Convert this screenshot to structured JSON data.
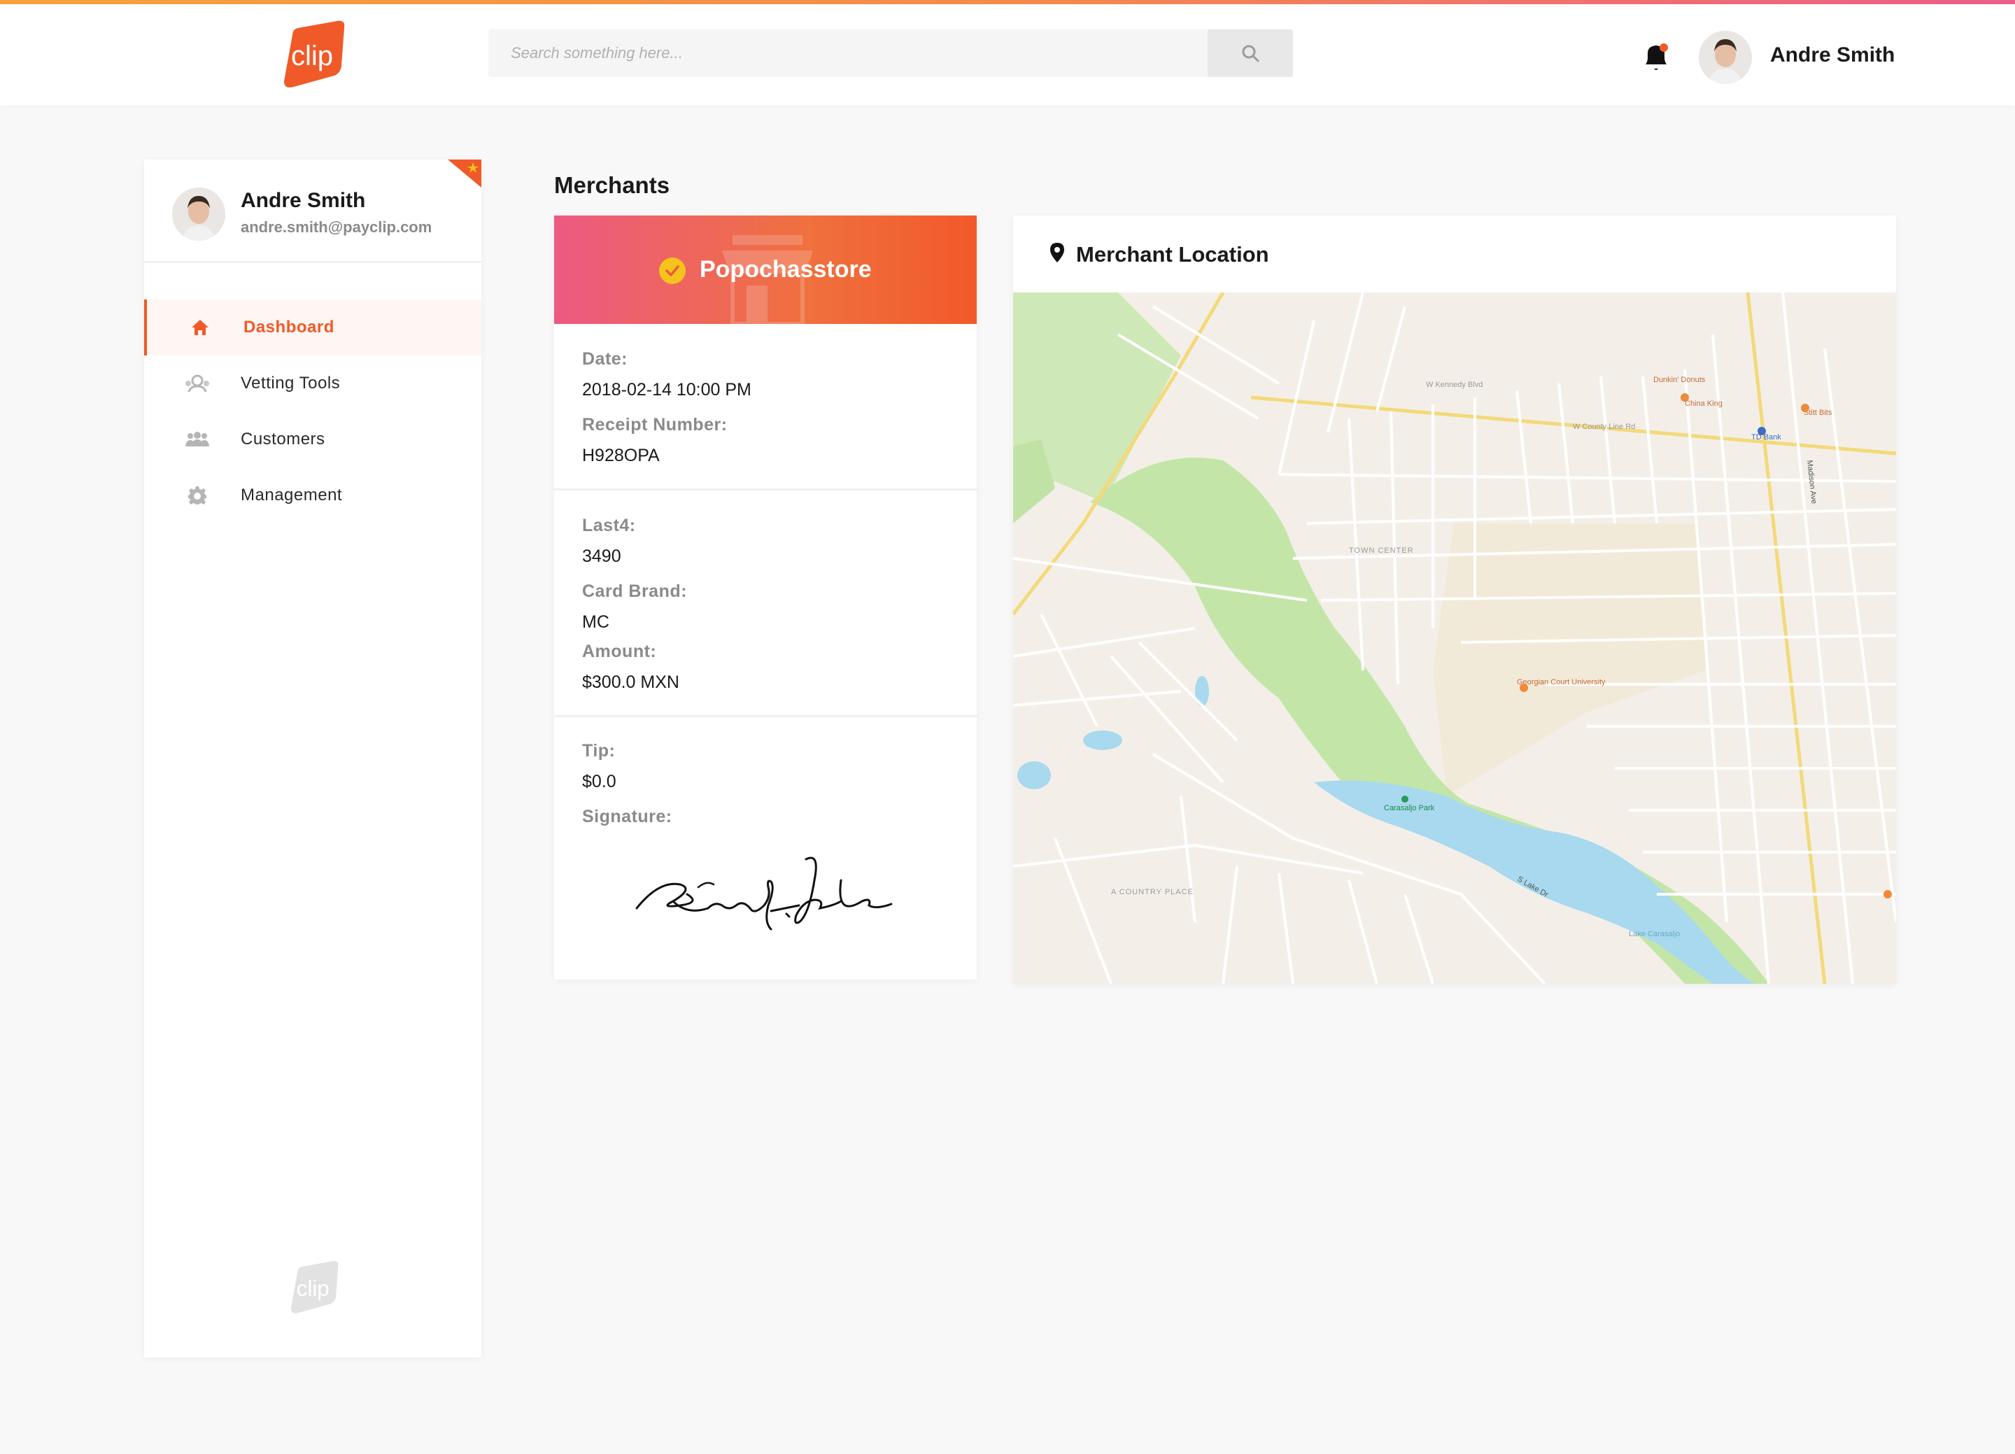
{
  "header": {
    "search": {
      "placeholder": "Search something here...",
      "value": ""
    },
    "user_name": "Andre Smith",
    "icons": [
      "clip-logo",
      "search-icon",
      "bell-icon",
      "avatar"
    ],
    "accent_gradient": [
      "#f7a23c",
      "#ec5d8a"
    ]
  },
  "brand": {
    "logo_text": "clip",
    "accent": "#f05a28"
  },
  "sidebar": {
    "profile": {
      "name": "Andre Smith",
      "email": "andre.smith@payclip.com"
    },
    "items": [
      {
        "label": "Dashboard",
        "icon": "home-icon",
        "active": true
      },
      {
        "label": "Vetting Tools",
        "icon": "vetting-icon",
        "active": false
      },
      {
        "label": "Customers",
        "icon": "users-icon",
        "active": false
      },
      {
        "label": "Management",
        "icon": "gear-icon",
        "active": false
      }
    ]
  },
  "main": {
    "title": "Merchants",
    "receipt": {
      "store_name": "Popochasstore",
      "date_label": "Date:",
      "date_value": "2018-02-14 10:00 PM",
      "receipt_label": "Receipt Number:",
      "receipt_value": "H928OPA",
      "last4_label": "Last4:",
      "last4_value": "3490",
      "brand_label": "Card Brand:",
      "brand_value": "MC",
      "amount_label": "Amount:",
      "amount_value": "$300.0 MXN",
      "tip_label": "Tip:",
      "tip_value": "$0.0",
      "signature_label": "Signature:"
    },
    "map": {
      "title": "Merchant Location",
      "labels": {
        "town_center": "TOWN CENTER",
        "park": "Carasaljo Park",
        "university": "Georgian Court University",
        "lake": "Lake Carasaljo",
        "country_place": "A COUNTRY PLACE",
        "madison": "Madison Ave",
        "county_line": "W County Line Rd",
        "kennedy": "W Kennedy Blvd",
        "lake_dr": "S Lake Dr",
        "td_bank": "TD Bank",
        "china_king": "China King",
        "dunkin": "Dunkin' Donuts",
        "stitt": "Stitt Bits"
      }
    }
  }
}
